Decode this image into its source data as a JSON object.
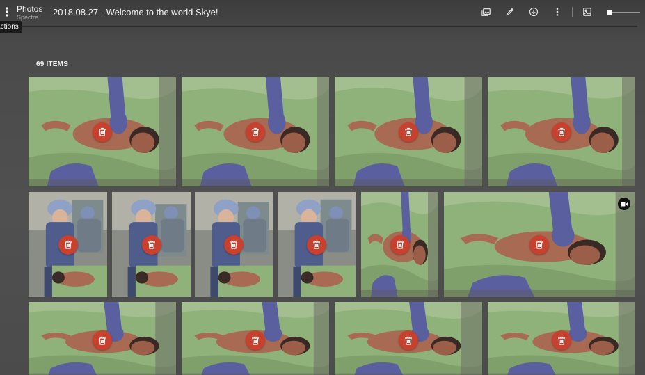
{
  "header": {
    "app_title": "Photos",
    "app_subtitle": "Spectre",
    "album_title": "2018.08.27 - Welcome to the world Skye!",
    "menu_tooltip": "Actions",
    "toolbar_icons": [
      "image-edit-icon",
      "pencil-icon",
      "download-icon",
      "more-vertical-icon",
      "image-icon"
    ]
  },
  "album": {
    "count_label": "69 ITEMS"
  },
  "grid": {
    "rows": [
      {
        "items": [
          {
            "scene": "infant-green-blanket",
            "media": "photo"
          },
          {
            "scene": "infant-green-blanket",
            "media": "photo"
          },
          {
            "scene": "infant-green-blanket",
            "media": "photo"
          },
          {
            "scene": "infant-green-blanket",
            "media": "photo"
          }
        ]
      },
      {
        "items": [
          {
            "scene": "clinician-with-infant",
            "media": "photo"
          },
          {
            "scene": "clinician-with-infant",
            "media": "photo"
          },
          {
            "scene": "clinician-with-infant",
            "media": "photo"
          },
          {
            "scene": "clinician-with-infant",
            "media": "photo"
          },
          {
            "scene": "infant-green-blanket",
            "media": "photo"
          },
          {
            "scene": "infant-green-blanket",
            "media": "video"
          }
        ]
      },
      {
        "items": [
          {
            "scene": "infant-green-blanket",
            "media": "photo"
          },
          {
            "scene": "infant-green-blanket",
            "media": "photo"
          },
          {
            "scene": "infant-green-blanket",
            "media": "photo"
          },
          {
            "scene": "infant-green-blanket",
            "media": "photo"
          }
        ]
      }
    ]
  },
  "colors": {
    "delete": "#c8402e",
    "blanket": "#8fb27a",
    "glove": "#5a5fa0",
    "skin": "#a86a52",
    "scrubs": "#4f5d8c"
  }
}
